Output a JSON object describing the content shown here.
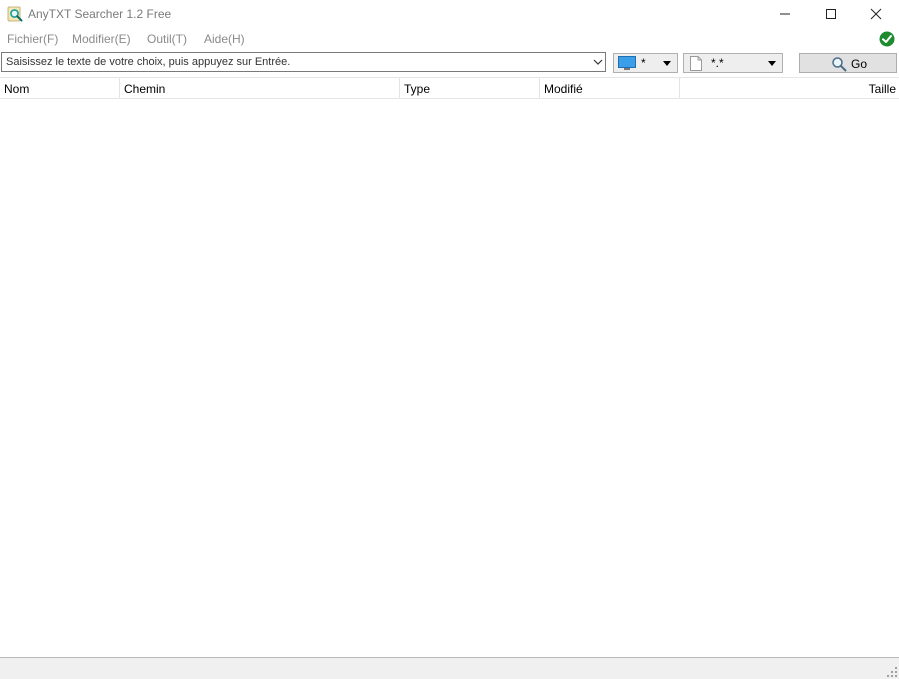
{
  "window": {
    "title": "AnyTXT Searcher 1.2 Free",
    "icon": "search-app-icon",
    "controls": [
      "minimize-icon",
      "maximize-icon",
      "close-icon"
    ]
  },
  "menu": {
    "items": [
      {
        "label": "Fichier(F)"
      },
      {
        "label": "Modifier(E)"
      },
      {
        "label": "Outil(T)"
      },
      {
        "label": "Aide(H)"
      }
    ],
    "status_icon": "check-circle-icon",
    "status_color": "#1e8a2e"
  },
  "toolbar": {
    "search": {
      "placeholder": "Saisissez le texte de votre choix, puis appuyez sur Entrée.",
      "value": ""
    },
    "drive_filter": {
      "value": "*",
      "icon": "monitor-icon",
      "icon_color": "#3a9ee8"
    },
    "extension_filter": {
      "value": "*.*",
      "icon": "document-icon"
    },
    "go_label": "Go"
  },
  "table": {
    "columns": [
      {
        "label": "Nom"
      },
      {
        "label": "Chemin"
      },
      {
        "label": "Type"
      },
      {
        "label": "Modifié"
      },
      {
        "label": "Taille"
      }
    ],
    "rows": []
  }
}
